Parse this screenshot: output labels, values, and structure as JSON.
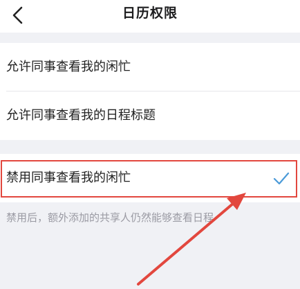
{
  "header": {
    "title": "日历权限",
    "back_icon": "chevron-left-icon"
  },
  "options": {
    "allow_busy": "允许同事查看我的闲忙",
    "allow_titles": "允许同事查看我的日程标题",
    "disable_busy": "禁用同事查看我的闲忙"
  },
  "selected_option": "disable_busy",
  "note": "禁用后，额外添加的共享人仍然能够查看日程",
  "colors": {
    "background": "#f0f1f5",
    "check": "#4a9ad8",
    "annotation": "#e2473e",
    "note_text": "#9a9aa3"
  },
  "annotation": {
    "type": "red-box-and-arrow",
    "target": "disable_busy"
  }
}
